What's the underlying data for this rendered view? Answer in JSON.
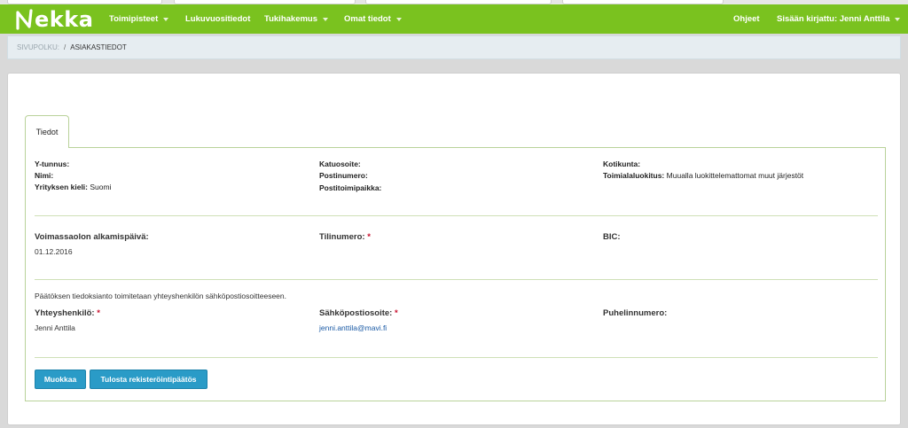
{
  "nav": {
    "logo_text": "ekka",
    "items": [
      {
        "label": "Toimipisteet",
        "dropdown": true
      },
      {
        "label": "Lukuvuositiedot",
        "dropdown": false
      },
      {
        "label": "Tukihakemus",
        "dropdown": true
      },
      {
        "label": "Omat tiedot",
        "dropdown": true
      }
    ],
    "help": "Ohjeet",
    "user": "Sisään kirjattu: Jenni Anttila"
  },
  "breadcrumb": {
    "label": "SIVUPOLKU:",
    "separator": "/",
    "current": "ASIAKASTIEDOT"
  },
  "tabs": [
    {
      "label": "Tiedot"
    }
  ],
  "company": {
    "col1": [
      {
        "label": "Y-tunnus:",
        "value": ""
      },
      {
        "label": "Nimi:",
        "value": ""
      },
      {
        "label": "Yrityksen kieli:",
        "value": "Suomi"
      }
    ],
    "col2": [
      {
        "label": "Katuosoite:",
        "value": ""
      },
      {
        "label": "Postinumero:",
        "value": ""
      },
      {
        "label": "Postitoimipaikka:",
        "value": ""
      }
    ],
    "col3": [
      {
        "label": "Kotikunta:",
        "value": ""
      },
      {
        "label": "Toimialaluokitus:",
        "value": "Muualla luokittelemattomat muut järjestöt"
      }
    ]
  },
  "banking": {
    "validity_label": "Voimassaolon alkamispäivä:",
    "validity_value": "01.12.2016",
    "account_label": "Tilinumero:",
    "bic_label": "BIC:"
  },
  "contact": {
    "notice": "Päätöksen tiedoksianto toimitetaan yhteyshenkilön sähköpostiosoitteeseen.",
    "person_label": "Yhteyshenkilö:",
    "person_value": "Jenni Anttila",
    "email_label": "Sähköpostiosoite:",
    "email_value": "jenni.anttila@mavi.fi",
    "phone_label": "Puhelinnumero:"
  },
  "required_mark": "*",
  "buttons": {
    "edit": "Muokkaa",
    "print": "Tulosta rekisteröintipäätös"
  },
  "colors": {
    "nav_green": "#7ac21f",
    "button_blue": "#2a9bc7",
    "required_red": "#c8102e"
  }
}
